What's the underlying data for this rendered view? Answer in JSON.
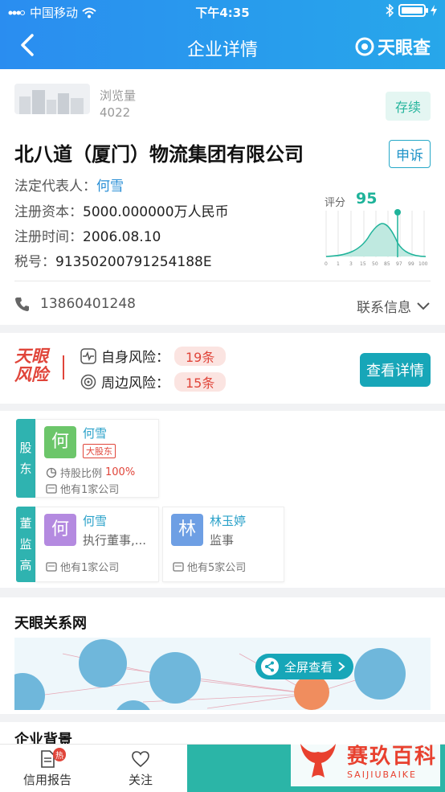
{
  "status_bar": {
    "carrier": "中国移动",
    "time": "下午4:35"
  },
  "nav": {
    "title": "企业详情",
    "brand": "天眼查"
  },
  "company": {
    "views_label": "浏览量",
    "views": "4022",
    "status_tag": "存续",
    "name": "北八道（厦门）物流集团有限公司",
    "appeal_label": "申诉",
    "legal_rep_label": "法定代表人：",
    "legal_rep": "何雪",
    "capital_label": "注册资本：",
    "capital": "5000.000000万人民币",
    "reg_time_label": "注册时间：",
    "reg_time": "2006.08.10",
    "tax_label": "税号：",
    "tax_id": "91350200791254188E",
    "score_label": "评分",
    "score": "95",
    "score_axis": [
      "0",
      "1",
      "3",
      "15",
      "50",
      "85",
      "97",
      "99",
      "100"
    ],
    "phone": "13860401248",
    "contact_label": "联系信息"
  },
  "risk": {
    "logo_line1": "天眼",
    "logo_line2": "风险",
    "self_label": "自身风险：",
    "self_count": "19条",
    "around_label": "周边风险：",
    "around_count": "15条",
    "detail_button": "查看详情"
  },
  "shareholders": {
    "tag": [
      "股",
      "东"
    ],
    "items": [
      {
        "avatar": "何",
        "name": "何雪",
        "badge": "大股东",
        "ratio_label": "持股比例",
        "ratio": "100%",
        "companies": "他有1家公司",
        "color": "#6cc66a"
      }
    ]
  },
  "executives": {
    "tag": [
      "董",
      "监",
      "高"
    ],
    "items": [
      {
        "avatar": "何",
        "name": "何雪",
        "role": "执行董事,...",
        "companies": "他有1家公司",
        "color": "#b48ae0"
      },
      {
        "avatar": "林",
        "name": "林玉婷",
        "role": "监事",
        "companies": "他有5家公司",
        "color": "#6e9fe4"
      }
    ]
  },
  "network": {
    "title": "天眼关系网",
    "fullscreen": "全屏查看"
  },
  "background": {
    "title": "企业背景"
  },
  "tabbar": {
    "report": "信用报告",
    "hot": "热",
    "follow": "关注"
  },
  "watermark": {
    "title": "赛玖百科",
    "subtitle": "SAIJIUBAIKE"
  },
  "colors": {
    "primary": "#2a8df0",
    "teal": "#17a6b8",
    "risk_red": "#e0453a",
    "green": "#1fb39a"
  }
}
